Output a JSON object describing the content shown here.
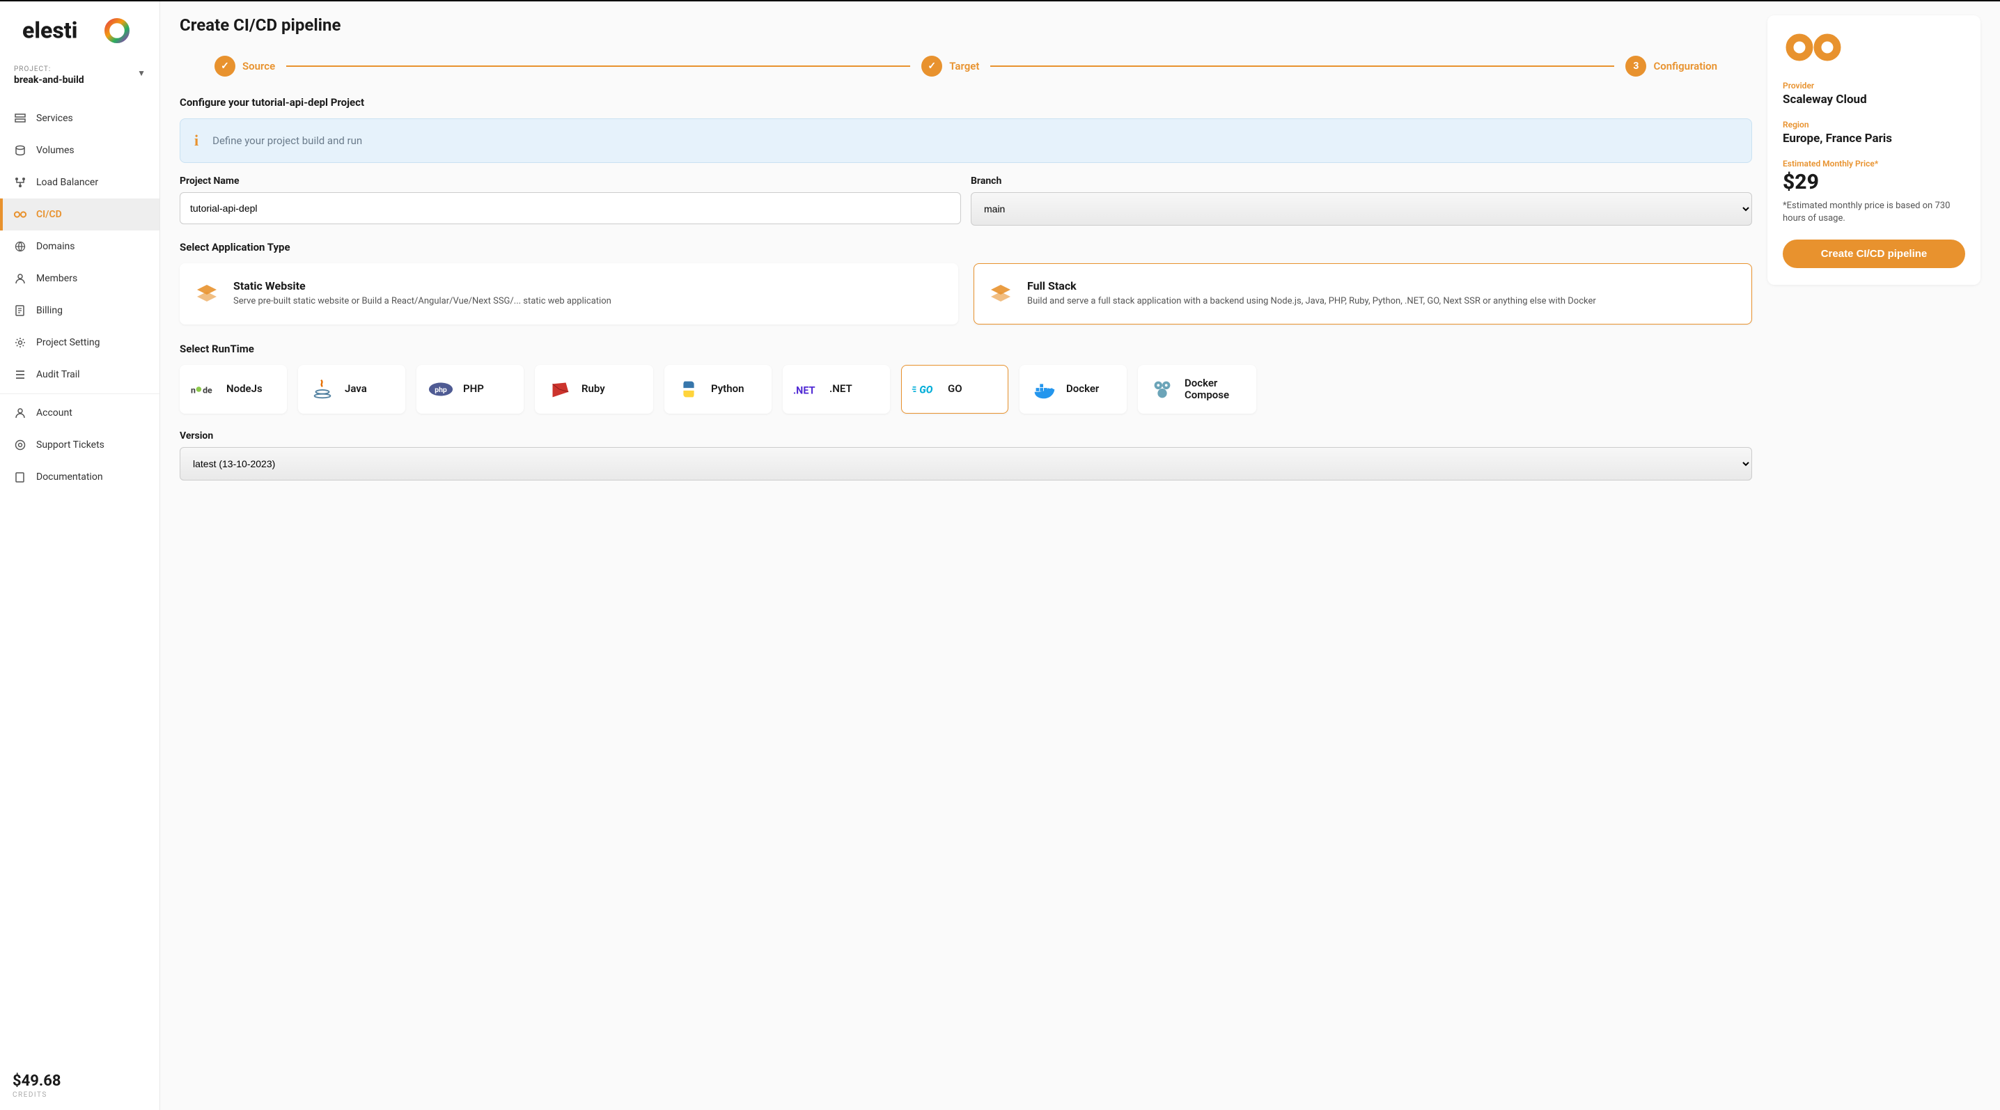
{
  "project": {
    "label": "PROJECT:",
    "name": "break-and-build"
  },
  "nav": {
    "services": "Services",
    "volumes": "Volumes",
    "load_balancer": "Load Balancer",
    "cicd": "CI/CD",
    "domains": "Domains",
    "members": "Members",
    "billing": "Billing",
    "project_setting": "Project Setting",
    "audit_trail": "Audit Trail",
    "account": "Account",
    "support_tickets": "Support Tickets",
    "documentation": "Documentation"
  },
  "credits": {
    "amount": "$49.68",
    "label": "CREDITS"
  },
  "page": {
    "title": "Create CI/CD pipeline"
  },
  "stepper": {
    "s1": {
      "label": "Source"
    },
    "s2": {
      "label": "Target"
    },
    "s3": {
      "num": "3",
      "label": "Configuration"
    }
  },
  "section": {
    "configure_title": "Configure your tutorial-api-depl Project",
    "info_text": "Define your project build and run",
    "project_name_label": "Project Name",
    "project_name_value": "tutorial-api-depl",
    "branch_label": "Branch",
    "branch_value": "main",
    "app_type_label": "Select Application Type",
    "runtime_label": "Select RunTime",
    "version_label": "Version",
    "version_value": "latest (13-10-2023)"
  },
  "app_types": {
    "static": {
      "title": "Static Website",
      "desc": "Serve pre-built static website or Build a React/Angular/Vue/Next SSG/... static web application"
    },
    "fullstack": {
      "title": "Full Stack",
      "desc": "Build and serve a full stack application with a backend using Node.js, Java, PHP, Ruby, Python, .NET, GO, Next SSR or anything else with Docker"
    }
  },
  "runtimes": {
    "nodejs": "NodeJs",
    "java": "Java",
    "php": "PHP",
    "ruby": "Ruby",
    "python": "Python",
    "dotnet": ".NET",
    "go": "GO",
    "docker": "Docker",
    "docker_compose": "Docker Compose"
  },
  "summary": {
    "provider_label": "Provider",
    "provider_value": "Scaleway Cloud",
    "region_label": "Region",
    "region_value": "Europe, France Paris",
    "price_label": "Estimated Monthly Price*",
    "price_value": "$29",
    "note": "*Estimated monthly price is based on 730 hours of usage.",
    "button": "Create CI/CD pipeline"
  }
}
